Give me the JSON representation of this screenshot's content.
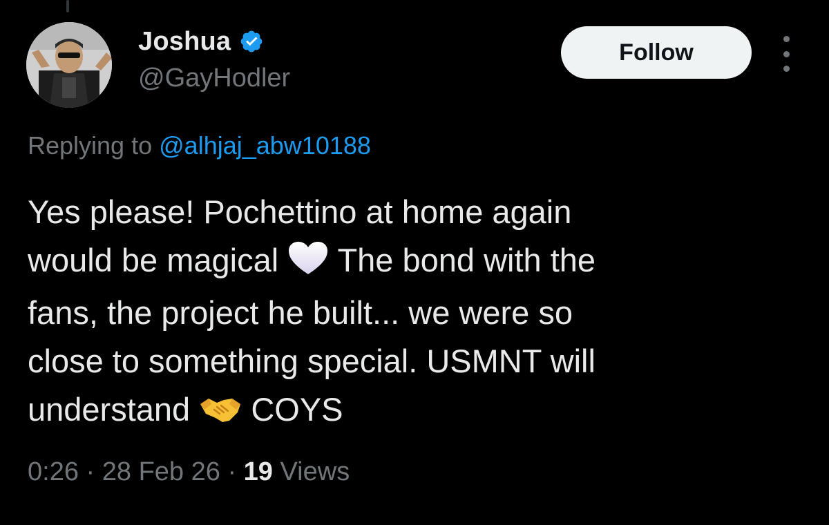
{
  "tweet": {
    "author": {
      "display_name": "Joshua",
      "handle": "@GayHodler",
      "verified": true,
      "avatar_icon": "user-avatar"
    },
    "follow_label": "Follow",
    "more_icon": "more-options-icon",
    "replying_prefix": "Replying to",
    "replying_to": "@alhjaj_abw10188",
    "text_lines": [
      {
        "parts": [
          "Yes please! Pochettino at home again"
        ]
      },
      {
        "before": "would be magical",
        "emoji": "white-heart-icon",
        "after": "The bond with the"
      },
      {
        "parts": [
          "fans, the project he built... we were so"
        ]
      },
      {
        "parts": [
          "close to something special. USMNT will"
        ]
      },
      {
        "before": "understand",
        "emoji": "handshake-icon",
        "after": "COYS"
      }
    ],
    "meta": {
      "time": "0:26",
      "separator": "·",
      "date": "28 Feb 26",
      "views_count": "19",
      "views_label": "Views"
    }
  },
  "colors": {
    "background": "#000000",
    "text_primary": "#e7e9ea",
    "text_secondary": "#71767b",
    "link": "#1d9bf0",
    "verified_badge": "#1d9bf0",
    "follow_button_bg": "#eff3f4",
    "follow_button_text": "#0f1419"
  }
}
